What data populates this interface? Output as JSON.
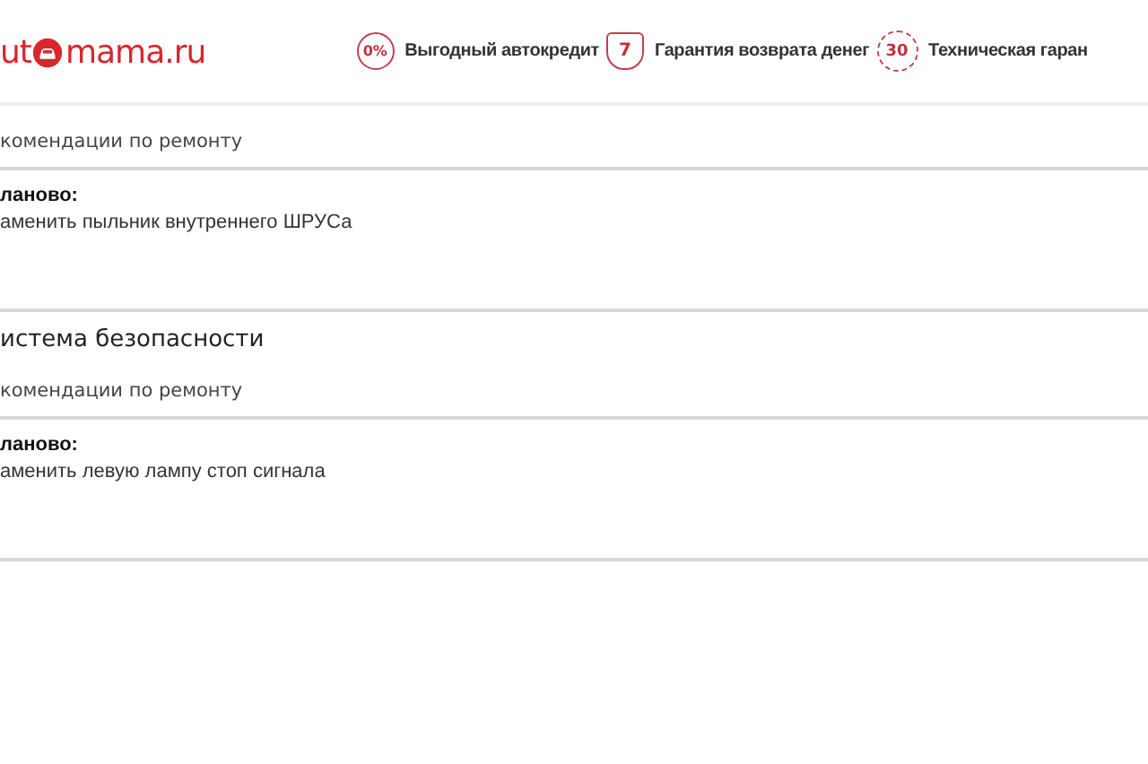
{
  "header": {
    "logo": [
      "ut",
      "mama.ru"
    ],
    "badges": [
      {
        "kind": "circle",
        "mark": "0%",
        "label": "Выгодный автокредит"
      },
      {
        "kind": "shield",
        "mark": "7",
        "label": "Гарантия возврата денег"
      },
      {
        "kind": "seal",
        "mark": "30",
        "label": "Техническая гаран"
      }
    ]
  },
  "sections": [
    {
      "subtitle": "комендации по ремонту",
      "items": [
        {
          "heading": "ланово:",
          "text": "аменить пыльник внутреннего ШРУСа"
        }
      ]
    },
    {
      "title": "истема безопасности",
      "subtitle": "комендации по ремонту",
      "items": [
        {
          "heading": "ланово:",
          "text": "аменить левую лампу стоп сигнала"
        }
      ]
    }
  ]
}
